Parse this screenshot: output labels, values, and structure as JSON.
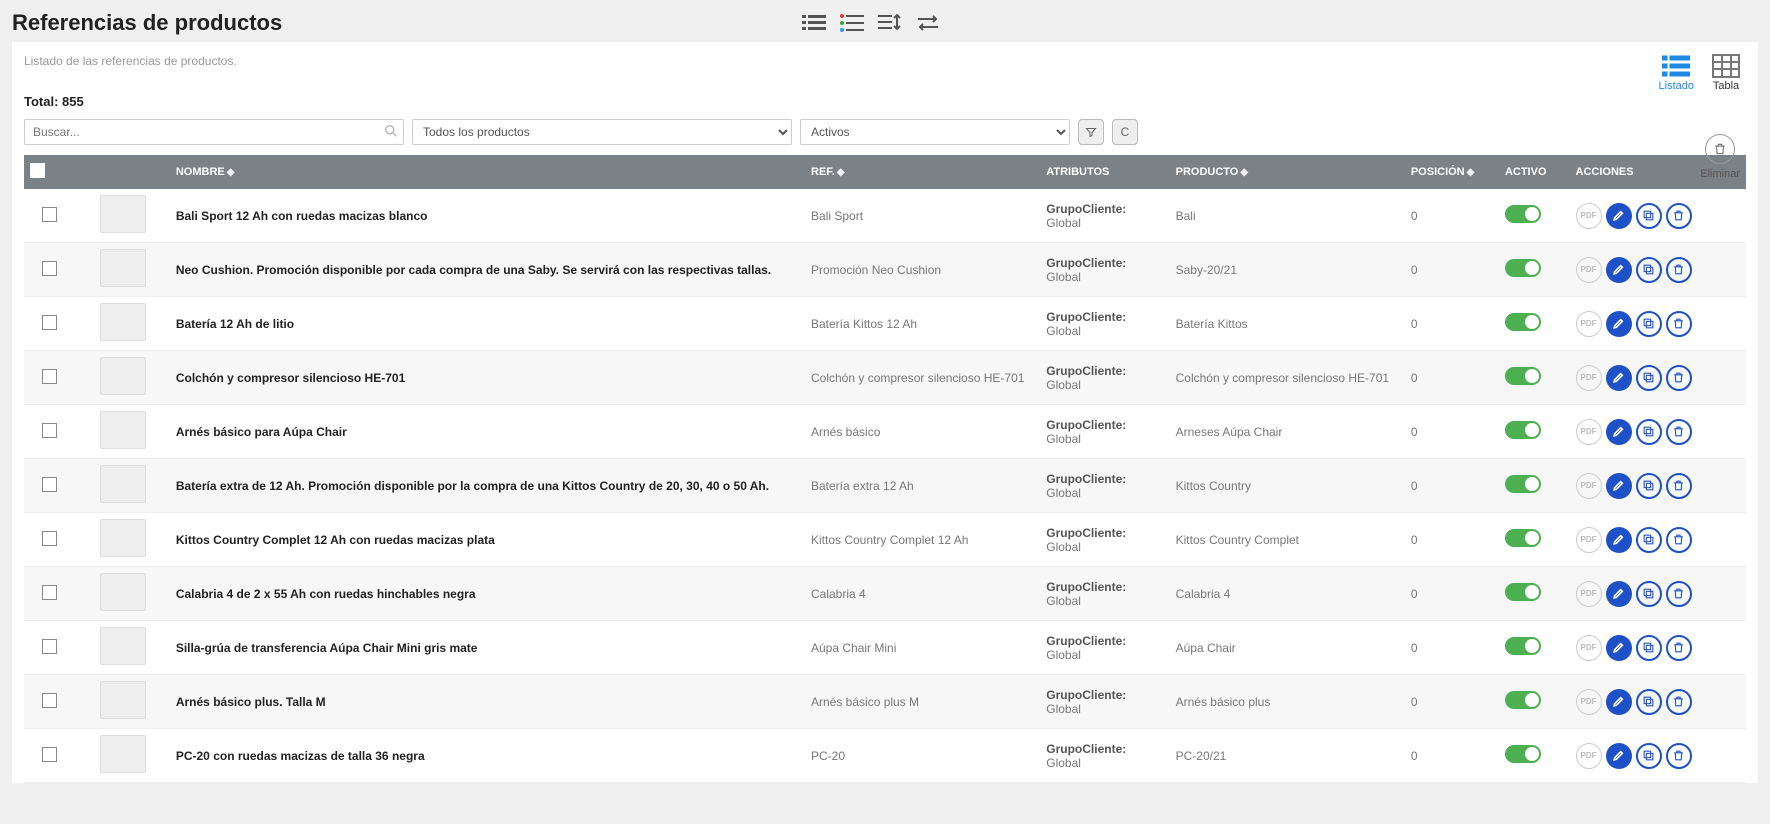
{
  "header": {
    "title": "Referencias de productos"
  },
  "panel": {
    "subtitle": "Listado de las referencias de productos.",
    "total_label": "Total:",
    "total_value": "855",
    "view_list": "Listado",
    "view_table": "Tabla",
    "delete_label": "Eliminar"
  },
  "filters": {
    "search_placeholder": "Buscar...",
    "product_filter": "Todos los productos",
    "status_filter": "Activos",
    "filter_btn": "⧩",
    "clear_btn": "C"
  },
  "columns": {
    "name": "NOMBRE",
    "ref": "REF.",
    "attr": "ATRIBUTOS",
    "prod": "PRODUCTO",
    "pos": "POSICIÓN",
    "active": "ACTIVO",
    "actions": "ACCIONES"
  },
  "attr_key": "GrupoCliente:",
  "attr_val": "Global",
  "pdf_label": "PDF",
  "rows": [
    {
      "name": "Bali Sport 12 Ah con ruedas macizas blanco",
      "ref": "Bali Sport",
      "prod": "Bali",
      "pos": "0"
    },
    {
      "name": "Neo Cushion. Promoción disponible por cada compra de una Saby. Se servirá con las respectivas tallas.",
      "ref": "Promoción Neo Cushion",
      "prod": "Saby-20/21",
      "pos": "0"
    },
    {
      "name": "Batería 12 Ah de litio",
      "ref": "Batería Kittos 12 Ah",
      "prod": "Batería Kittos",
      "pos": "0"
    },
    {
      "name": "Colchón y compresor silencioso HE-701",
      "ref": "Colchón y compresor silencioso HE-701",
      "prod": "Colchón y compresor silencioso HE-701",
      "pos": "0"
    },
    {
      "name": "Arnés básico para Aúpa Chair",
      "ref": "Arnés básico",
      "prod": "Arneses Aúpa Chair",
      "pos": "0"
    },
    {
      "name": "Batería extra de 12 Ah. Promoción disponible por la compra de una Kittos Country de 20, 30, 40 o 50 Ah.",
      "ref": "Batería extra 12 Ah",
      "prod": "Kittos Country",
      "pos": "0"
    },
    {
      "name": "Kittos Country Complet 12 Ah con ruedas macizas plata",
      "ref": "Kittos Country Complet 12 Ah",
      "prod": "Kittos Country Complet",
      "pos": "0"
    },
    {
      "name": "Calabria 4 de 2 x 55 Ah con ruedas hinchables negra",
      "ref": "Calabria 4",
      "prod": "Calabria 4",
      "pos": "0"
    },
    {
      "name": "Silla-grúa de transferencia Aúpa Chair Mini gris mate",
      "ref": "Aúpa Chair Mini",
      "prod": "Aúpa Chair",
      "pos": "0"
    },
    {
      "name": "Arnés básico plus. Talla M",
      "ref": "Arnés básico plus M",
      "prod": "Arnés básico plus",
      "pos": "0"
    },
    {
      "name": "PC-20 con ruedas macizas de talla 36 negra",
      "ref": "PC-20",
      "prod": "PC-20/21",
      "pos": "0"
    }
  ]
}
